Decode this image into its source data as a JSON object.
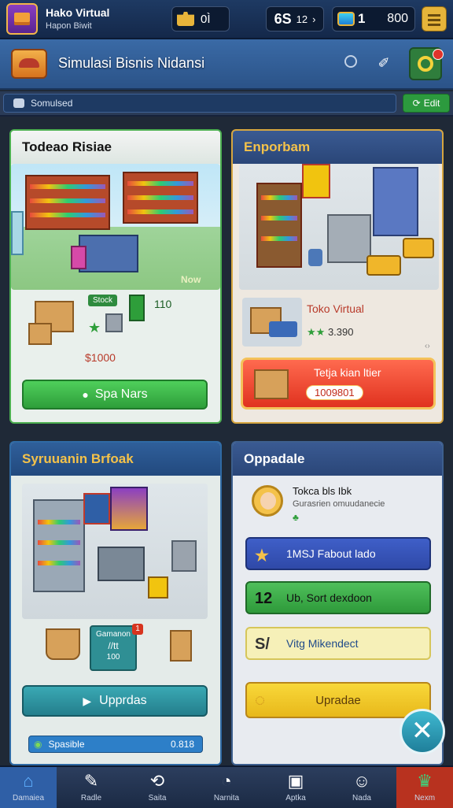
{
  "topbar": {
    "app_title": "Hako Virtual",
    "app_subtitle": "Hapon Biwit",
    "puzzle_count": "0Ì",
    "level_text": "6S",
    "level_sub": "12",
    "arrow": "›",
    "gem_count": "1",
    "coins": "800"
  },
  "header": {
    "title": "Simulasi Bisnis Nidansi",
    "wrench_glyph": "✐"
  },
  "status": {
    "text": "Somulsed"
  },
  "status_button": {
    "label": "Edit"
  },
  "card1": {
    "title": "Todeao Risiae",
    "scene_tag": "Now",
    "badge": "Stock",
    "badge_count": "110",
    "price": "$1000",
    "button": "Spa Nars"
  },
  "card2": {
    "title": "Enporbam",
    "shop_name": "Toko Virtual",
    "rating": "3.390",
    "promo_title": "Tetja kian ltier",
    "promo_price": "1009801",
    "corner": "‹›"
  },
  "card3": {
    "title": "Syruuanin Brfoak",
    "info_title": "Gamanon",
    "info_line": "//tt",
    "info_value": "100",
    "notif": "1",
    "button": "Upprdas",
    "footer_left": "Spasible",
    "footer_right": "0.818"
  },
  "card4": {
    "title": "Oppadale",
    "profile_name": "Tokca bls  Ibk",
    "profile_desc": "Gurasrien omuudanecie",
    "options": [
      {
        "lead": "★",
        "label": "1MSJ Fabout lado"
      },
      {
        "lead": "12",
        "label": "Ub, Sort dexdoon"
      },
      {
        "lead": "S/",
        "label": "Vitg Mikendect"
      }
    ],
    "button": "Upradae"
  },
  "tabs": [
    {
      "label": "Damaiea",
      "icon": "⌂"
    },
    {
      "label": "Radle",
      "icon": "✎"
    },
    {
      "label": "Saita",
      "icon": "⟲"
    },
    {
      "label": "Narnita",
      "icon": "◔"
    },
    {
      "label": "Aptka",
      "icon": "▣"
    },
    {
      "label": "Nada",
      "icon": "☺"
    },
    {
      "label": "Nexm",
      "icon": "♛"
    }
  ],
  "fab": {
    "icon": "✕"
  }
}
